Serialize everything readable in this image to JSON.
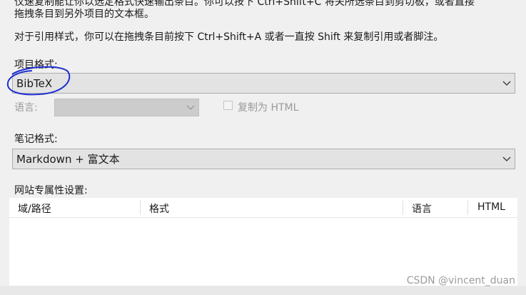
{
  "instructions": {
    "line1": "仅速复制能让你以选定格式快速输出条目。你可以按下 Ctrl+Shift+C 将关所选条目到剪切板，或者直接",
    "line2": "拖拽条目到另外项目的文本框。",
    "line3": "对于引用样式，你可以在拖拽条目前按下 Ctrl+Shift+A 或者一直按 Shift 来复制引用或者脚注。"
  },
  "item_format": {
    "label": "项目格式:",
    "value": "BibTeX",
    "annotation_color": "#1f2fcf"
  },
  "language": {
    "label": "语言:",
    "value": ""
  },
  "copy_html": {
    "label": "复制为 HTML",
    "checked": false
  },
  "note_format": {
    "label": "笔记格式:",
    "value": "Markdown + 富文本"
  },
  "site_settings": {
    "label": "网站专属性设置:",
    "columns": [
      "域/路径",
      "格式",
      "语言",
      "HTML"
    ]
  },
  "watermark": "CSDN @vincent_duan",
  "icons": {
    "dropdown": "chevron-down-icon"
  }
}
